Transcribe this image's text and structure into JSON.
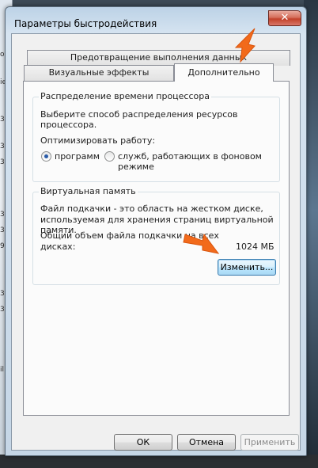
{
  "background": {
    "left_stubs": [
      "o",
      "ie",
      "3",
      "3",
      "3",
      "3",
      "3",
      "9",
      "3",
      "3",
      "il"
    ]
  },
  "window": {
    "title": "Параметры быстродействия",
    "close_glyph": "✕"
  },
  "tabs": {
    "dep": "Предотвращение выполнения данных",
    "visual": "Визуальные эффекты",
    "advanced": "Дополнительно"
  },
  "cpu_group": {
    "title": "Распределение времени процессора",
    "description": "Выберите способ распределения ресурсов процессора.",
    "optimize_label": "Оптимизировать работу:",
    "option_programs": "программ",
    "option_services": "служб, работающих в фоновом режиме",
    "selected": "программ"
  },
  "vm_group": {
    "title": "Виртуальная память",
    "description_line1": "Файл подкачки - это область на жестком диске,",
    "description_line2": "используемая для хранения страниц виртуальной памяти.",
    "total_label_line1": "Общий объем файла подкачки на всех",
    "total_label_line2": "дисках:",
    "total_value": "1024 МБ",
    "change_button": "Изменить..."
  },
  "footer": {
    "ok": "ОК",
    "cancel": "Отмена",
    "apply": "Применить"
  },
  "colors": {
    "annotation_arrow": "#f26a1b",
    "close_button": "#c2412a"
  }
}
